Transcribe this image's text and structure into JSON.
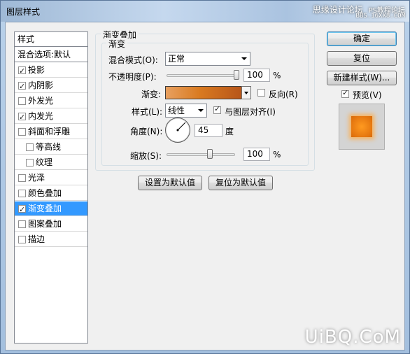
{
  "window": {
    "title": "图层样式",
    "watermark": "思缘设计论坛",
    "watermark_ps": "PS教程论坛",
    "watermark_url": "BBS.16XX8.COM",
    "bottom_watermark": "UiBQ.CoM"
  },
  "left_panel": {
    "header": "样式",
    "blending": "混合选项:默认",
    "items": [
      {
        "label": "投影",
        "checked": true
      },
      {
        "label": "内阴影",
        "checked": true
      },
      {
        "label": "外发光",
        "checked": false
      },
      {
        "label": "内发光",
        "checked": true
      },
      {
        "label": "斜面和浮雕",
        "checked": false
      },
      {
        "label": "等高线",
        "checked": false
      },
      {
        "label": "纹理",
        "checked": false
      },
      {
        "label": "光泽",
        "checked": false
      },
      {
        "label": "颜色叠加",
        "checked": false
      },
      {
        "label": "渐变叠加",
        "checked": true
      },
      {
        "label": "图案叠加",
        "checked": false
      },
      {
        "label": "描边",
        "checked": false
      }
    ]
  },
  "gradient_overlay": {
    "group_title": "渐变叠加",
    "sub_group_title": "渐变",
    "blend_mode_label": "混合模式(O):",
    "blend_mode_value": "正常",
    "opacity_label": "不透明度(P):",
    "opacity_value": "100",
    "opacity_unit": "%",
    "gradient_label": "渐变:",
    "reverse_label": "反向(R)",
    "reverse_checked": false,
    "style_label": "样式(L):",
    "style_value": "线性",
    "align_label": "与图层对齐(I)",
    "align_checked": true,
    "angle_label": "角度(N):",
    "angle_value": "45",
    "angle_unit": "度",
    "scale_label": "缩放(S):",
    "scale_value": "100",
    "scale_unit": "%",
    "make_default": "设置为默认值",
    "reset_default": "复位为默认值"
  },
  "right_buttons": {
    "ok": "确定",
    "reset": "复位",
    "new_style": "新建样式(W)...",
    "preview_label": "预览(V)",
    "preview_checked": true
  },
  "colors": {
    "selected_bg": "#3399ff",
    "gradient_start": "#e8a060",
    "gradient_end": "#b7561a",
    "preview_orange": "#f08a1c"
  }
}
